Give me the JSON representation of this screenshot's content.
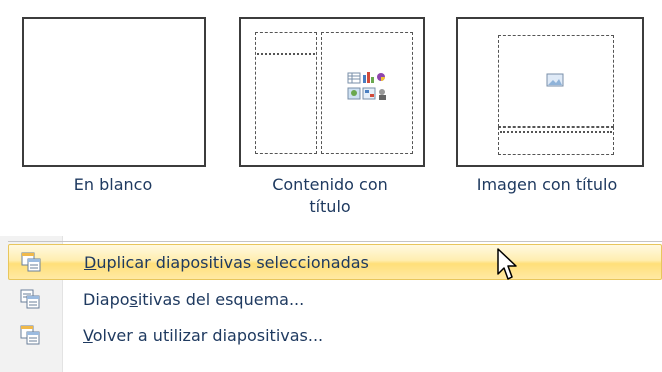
{
  "layouts": [
    {
      "label": "En blanco",
      "icon": "blank-layout-icon"
    },
    {
      "label_line1": "Contenido con",
      "label_line2": "título",
      "icon": "content-with-caption-layout-icon"
    },
    {
      "label": "Imagen con título",
      "icon": "picture-with-caption-layout-icon"
    }
  ],
  "menu": {
    "items": [
      {
        "label": "Duplicar diapositivas seleccionadas",
        "accesskey": "D",
        "icon": "duplicate-slides-icon",
        "highlighted": true
      },
      {
        "label": "Diapositivas del esquema...",
        "accesskey": "s",
        "icon": "slides-from-outline-icon",
        "highlighted": false
      },
      {
        "label": "Volver a utilizar diapositivas...",
        "accesskey": "V",
        "icon": "reuse-slides-icon",
        "highlighted": false
      }
    ]
  },
  "colors": {
    "text": "#1f3a60",
    "highlight_top": "#fff9e0",
    "highlight_bottom": "#ffdf79",
    "highlight_border": "#e8c65c"
  }
}
